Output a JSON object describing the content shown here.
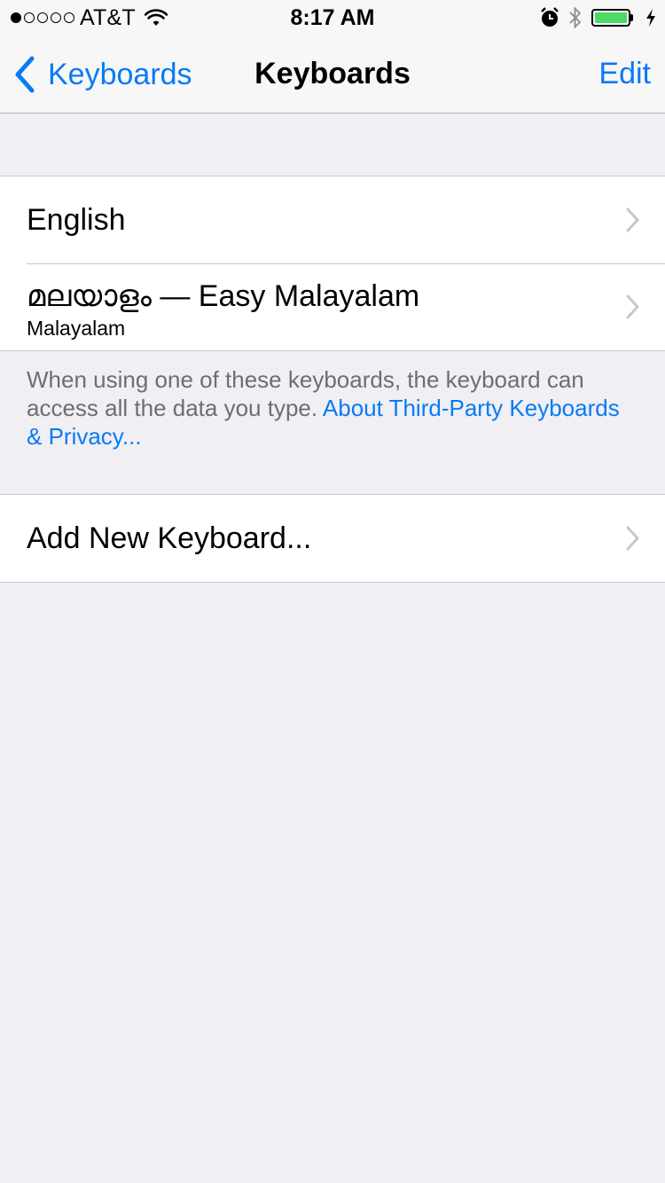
{
  "status_bar": {
    "carrier": "AT&T",
    "signal_dots_filled": 1,
    "signal_dots_total": 5,
    "time": "8:17 AM",
    "battery_level": 1.0,
    "icons": [
      "wifi-icon",
      "alarm-icon",
      "bluetooth-icon",
      "battery-icon",
      "charging-bolt-icon"
    ],
    "battery_color": "#4cd964"
  },
  "nav": {
    "back_label": "Keyboards",
    "title": "Keyboards",
    "edit_label": "Edit",
    "accent_color": "#0a7af5"
  },
  "keyboards": [
    {
      "title": "English",
      "subtitle": ""
    },
    {
      "title": "മലയാളം — Easy Malayalam",
      "subtitle": "Malayalam"
    }
  ],
  "footer": {
    "text": "When using one of these keyboards, the keyboard can access all the data you type.",
    "link": "About Third-Party Keyboards & Privacy..."
  },
  "add_keyboard": {
    "label": "Add New Keyboard..."
  }
}
